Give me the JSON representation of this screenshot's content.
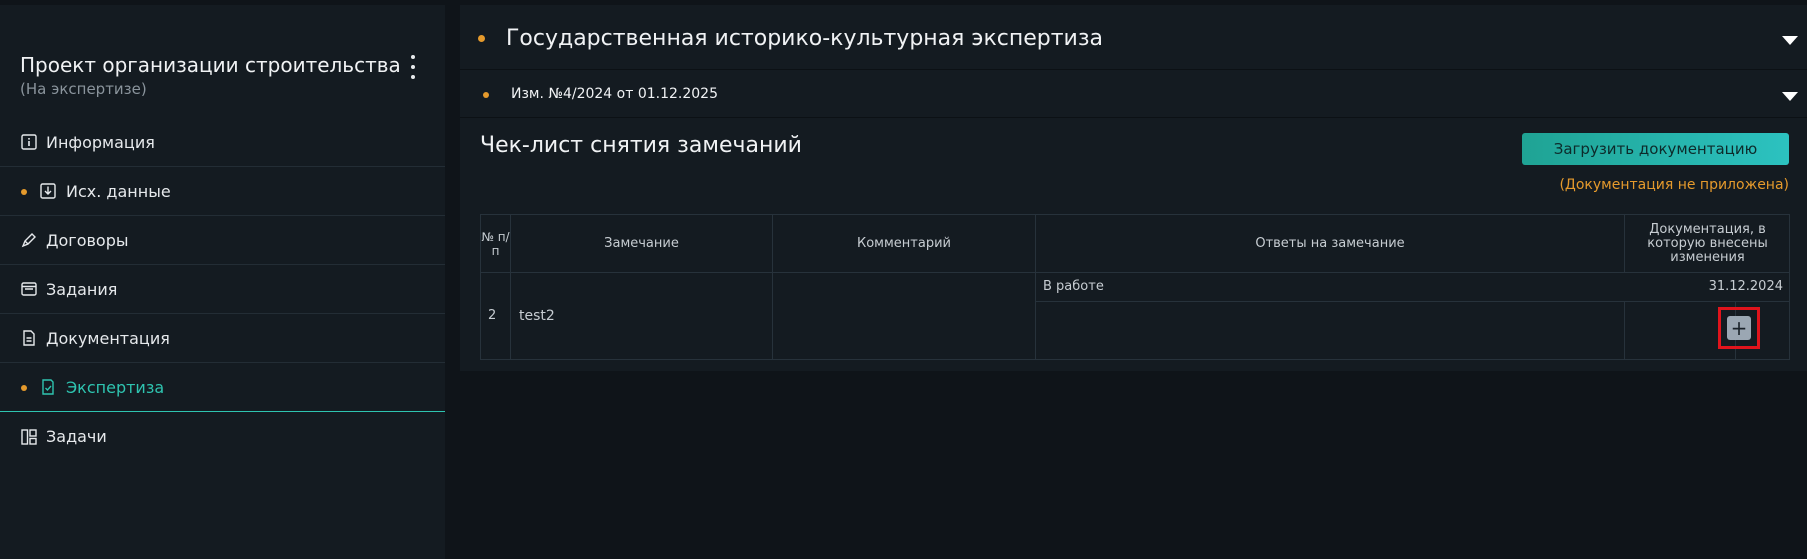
{
  "sidebar": {
    "project_title": "Проект организации строительства",
    "project_status": "(На экспертизе)",
    "items": [
      {
        "label": "Информация",
        "icon": "info-icon",
        "dot": false
      },
      {
        "label": "Исх. данные",
        "icon": "download-box-icon",
        "dot": true
      },
      {
        "label": "Договоры",
        "icon": "pen-icon",
        "dot": false
      },
      {
        "label": "Задания",
        "icon": "windows-icon",
        "dot": false
      },
      {
        "label": "Документация",
        "icon": "document-icon",
        "dot": false
      },
      {
        "label": "Экспертиза",
        "icon": "checklist-icon",
        "dot": true,
        "active": true
      },
      {
        "label": "Задачи",
        "icon": "kanban-icon",
        "dot": false
      }
    ]
  },
  "main": {
    "section_title": "Государственная историко-культурная экспертиза",
    "subsection_title": "Изм. №4/2024 от 01.12.2025",
    "checklist_title": "Чек-лист снятия замечаний",
    "upload_label": "Загрузить документацию",
    "no_doc_note": "(Документация не приложена)",
    "table": {
      "headers": [
        "№ п/ п",
        "Замечание",
        "Комментарий",
        "Ответы на замечание",
        "Документация, в которую внесены изменения"
      ],
      "rows": [
        {
          "num": "2",
          "remark": "test2",
          "comment": "",
          "answer_status": "В работе",
          "answer_date": "31.12.2024"
        }
      ]
    },
    "add_button_label": "+"
  },
  "colors": {
    "accent": "#2ec4b0",
    "dot": "#e59a2c",
    "highlight": "#e0141c"
  }
}
